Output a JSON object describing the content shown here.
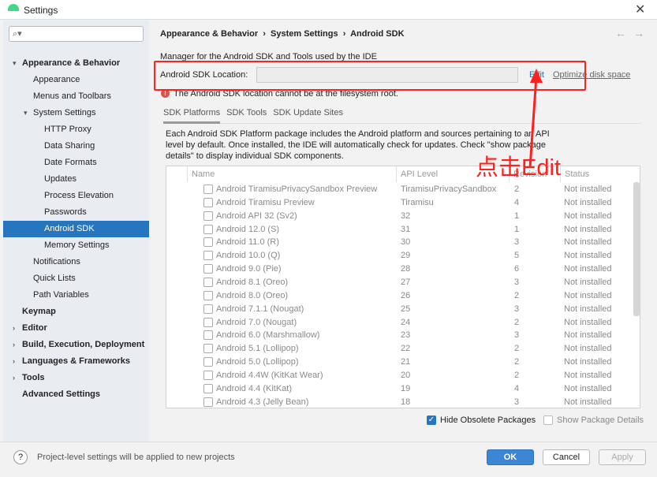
{
  "window": {
    "title": "Settings"
  },
  "search": {
    "placeholder": ""
  },
  "sidebar": {
    "items": [
      {
        "label": "Appearance & Behavior",
        "level": 0,
        "bold": true,
        "chev": "▾"
      },
      {
        "label": "Appearance",
        "level": 1
      },
      {
        "label": "Menus and Toolbars",
        "level": 1
      },
      {
        "label": "System Settings",
        "level": 1,
        "chev": "▾"
      },
      {
        "label": "HTTP Proxy",
        "level": 2
      },
      {
        "label": "Data Sharing",
        "level": 2
      },
      {
        "label": "Date Formats",
        "level": 2
      },
      {
        "label": "Updates",
        "level": 2
      },
      {
        "label": "Process Elevation",
        "level": 2
      },
      {
        "label": "Passwords",
        "level": 2
      },
      {
        "label": "Android SDK",
        "level": 2,
        "selected": true
      },
      {
        "label": "Memory Settings",
        "level": 2
      },
      {
        "label": "Notifications",
        "level": 1
      },
      {
        "label": "Quick Lists",
        "level": 1
      },
      {
        "label": "Path Variables",
        "level": 1
      },
      {
        "label": "Keymap",
        "level": 0,
        "bold": true
      },
      {
        "label": "Editor",
        "level": 0,
        "bold": true,
        "chev": "›"
      },
      {
        "label": "Build, Execution, Deployment",
        "level": 0,
        "bold": true,
        "chev": "›"
      },
      {
        "label": "Languages & Frameworks",
        "level": 0,
        "bold": true,
        "chev": "›"
      },
      {
        "label": "Tools",
        "level": 0,
        "bold": true,
        "chev": "›"
      },
      {
        "label": "Advanced Settings",
        "level": 0,
        "bold": true
      }
    ]
  },
  "breadcrumb": [
    "Appearance & Behavior",
    "System Settings",
    "Android SDK"
  ],
  "main": {
    "description": "Manager for the Android SDK and Tools used by the IDE",
    "location_label": "Android SDK Location:",
    "location_value": "",
    "edit_link": "Edit",
    "optimize_link": "Optimize disk space",
    "error": "The Android SDK location cannot be at the filesystem root.",
    "tabs": [
      "SDK Platforms",
      "SDK Tools",
      "SDK Update Sites"
    ],
    "info1": "Each Android SDK Platform package includes the Android platform and sources pertaining to an API",
    "info2": "level by default. Once installed, the IDE will automatically check for updates. Check \"show package",
    "info3": "details\" to display individual SDK components.",
    "columns": [
      "Name",
      "API Level",
      "Revision",
      "Status"
    ],
    "rows": [
      [
        "Android TiramisuPrivacySandbox Preview",
        "TiramisuPrivacySandbox",
        "2",
        "Not installed"
      ],
      [
        "Android Tiramisu Preview",
        "Tiramisu",
        "4",
        "Not installed"
      ],
      [
        "Android API 32 (Sv2)",
        "32",
        "1",
        "Not installed"
      ],
      [
        "Android 12.0 (S)",
        "31",
        "1",
        "Not installed"
      ],
      [
        "Android 11.0 (R)",
        "30",
        "3",
        "Not installed"
      ],
      [
        "Android 10.0 (Q)",
        "29",
        "5",
        "Not installed"
      ],
      [
        "Android 9.0 (Pie)",
        "28",
        "6",
        "Not installed"
      ],
      [
        "Android 8.1 (Oreo)",
        "27",
        "3",
        "Not installed"
      ],
      [
        "Android 8.0 (Oreo)",
        "26",
        "2",
        "Not installed"
      ],
      [
        "Android 7.1.1 (Nougat)",
        "25",
        "3",
        "Not installed"
      ],
      [
        "Android 7.0 (Nougat)",
        "24",
        "2",
        "Not installed"
      ],
      [
        "Android 6.0 (Marshmallow)",
        "23",
        "3",
        "Not installed"
      ],
      [
        "Android 5.1 (Lollipop)",
        "22",
        "2",
        "Not installed"
      ],
      [
        "Android 5.0 (Lollipop)",
        "21",
        "2",
        "Not installed"
      ],
      [
        "Android 4.4W (KitKat Wear)",
        "20",
        "2",
        "Not installed"
      ],
      [
        "Android 4.4 (KitKat)",
        "19",
        "4",
        "Not installed"
      ],
      [
        "Android 4.3 (Jelly Bean)",
        "18",
        "3",
        "Not installed"
      ]
    ],
    "hide_obsolete": "Hide Obsolete Packages",
    "show_details": "Show Package Details"
  },
  "annotation": "点击Edit",
  "footer": {
    "help": "?",
    "note": "Project-level settings will be applied to new projects",
    "ok": "OK",
    "cancel": "Cancel",
    "apply": "Apply"
  },
  "colors": {
    "accent": "#2675bf",
    "annotation": "#ff2020"
  }
}
